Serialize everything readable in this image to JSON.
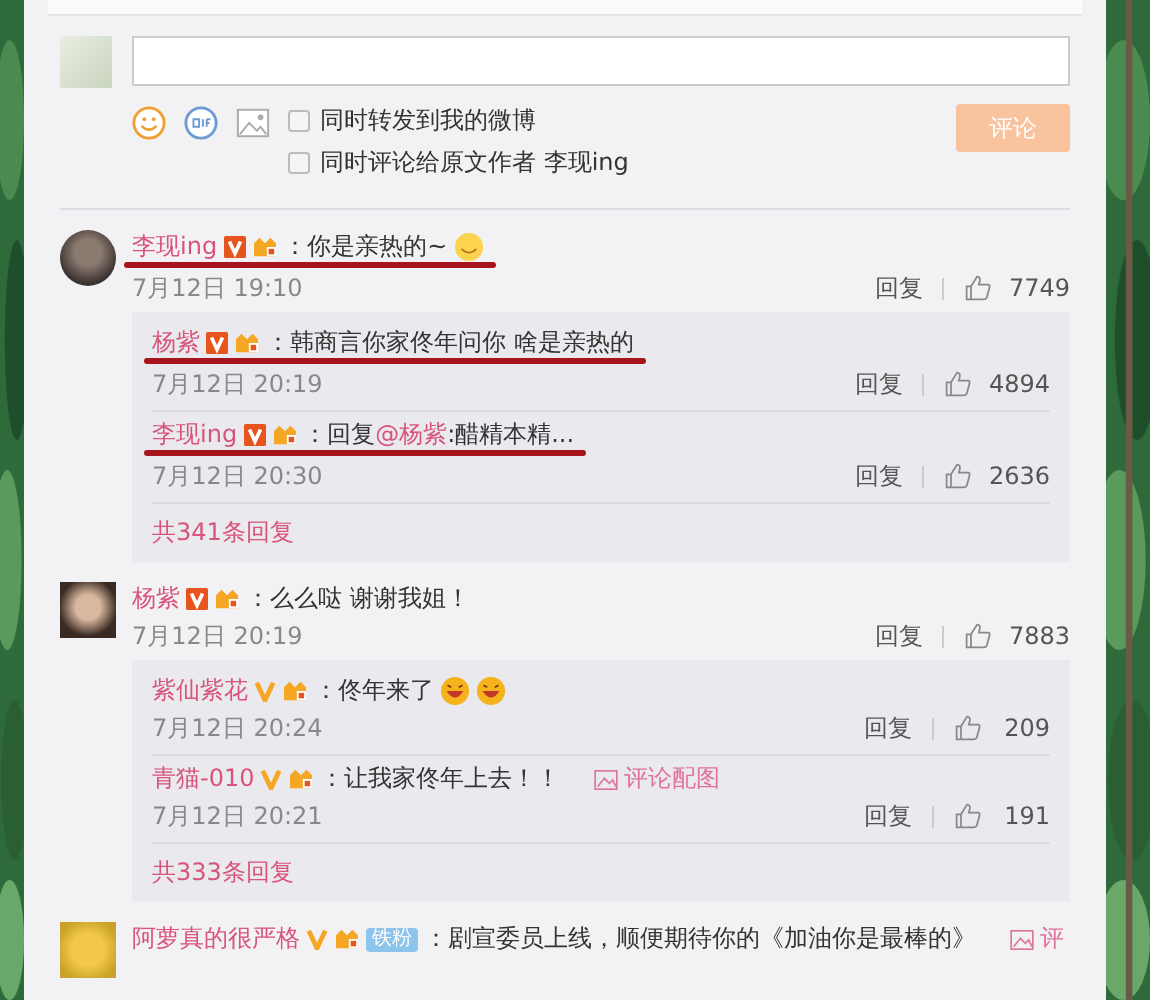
{
  "compose": {
    "options": [
      {
        "label": "同时转发到我的微博",
        "checked": false
      },
      {
        "label": "同时评论给原文作者 李现ing",
        "checked": false
      }
    ],
    "submit": {
      "label": "评论",
      "disabled": true
    }
  },
  "comments": [
    {
      "name": "李现ing",
      "badge": {
        "kind": "square"
      },
      "underlined": true,
      "parts": [
        {
          "kind": "text",
          "text": "：你是亲热的~"
        }
      ],
      "emojis": [
        {
          "kind": "smile"
        }
      ],
      "date": "7月12日 19:10",
      "reply": "回复",
      "likes": "7749",
      "replies": [
        {
          "name": "杨紫",
          "badge": {
            "kind": "square"
          },
          "underlined": true,
          "parts": [
            {
              "kind": "text",
              "text": "：韩商言你家佟年问你 啥是亲热的"
            }
          ],
          "date": "7月12日 20:19",
          "reply": "回复",
          "likes": "4894"
        },
        {
          "name": "李现ing",
          "badge": {
            "kind": "square"
          },
          "underlined": true,
          "parts": [
            {
              "kind": "text",
              "text": "：回复"
            },
            {
              "kind": "mention",
              "text": "@杨紫"
            },
            {
              "kind": "text",
              "text": ":醋精本精..."
            }
          ],
          "date": "7月12日 20:30",
          "reply": "回复",
          "likes": "2636"
        }
      ],
      "more": "共341条回复"
    },
    {
      "name": "杨紫",
      "badge": {
        "kind": "square"
      },
      "underlined": false,
      "parts": [
        {
          "kind": "text",
          "text": "：么么哒 谢谢我姐！"
        }
      ],
      "date": "7月12日 20:19",
      "reply": "回复",
      "likes": "7883",
      "replies": [
        {
          "name": "紫仙紫花",
          "badge": {
            "kind": "plain"
          },
          "underlined": false,
          "parts": [
            {
              "kind": "text",
              "text": "：佟年来了"
            }
          ],
          "emojis": [
            {
              "kind": "laugh"
            },
            {
              "kind": "laugh"
            }
          ],
          "date": "7月12日 20:24",
          "reply": "回复",
          "likes": "209"
        },
        {
          "name": "青猫-010",
          "badge": {
            "kind": "plain"
          },
          "underlined": false,
          "parts": [
            {
              "kind": "text",
              "text": "：让我家佟年上去！！"
            }
          ],
          "attachment": "评论配图",
          "date": "7月12日 20:21",
          "reply": "回复",
          "likes": "191"
        }
      ],
      "more": "共333条回复"
    },
    {
      "name": "阿萝真的很严格",
      "badge": {
        "kind": "plain"
      },
      "underlined": false,
      "fan_badge": "铁粉",
      "parts": [
        {
          "kind": "text",
          "text": "：剧宣委员上线，顺便期待你的《加油你是最棒的》"
        }
      ],
      "attachment": "评"
    }
  ]
}
